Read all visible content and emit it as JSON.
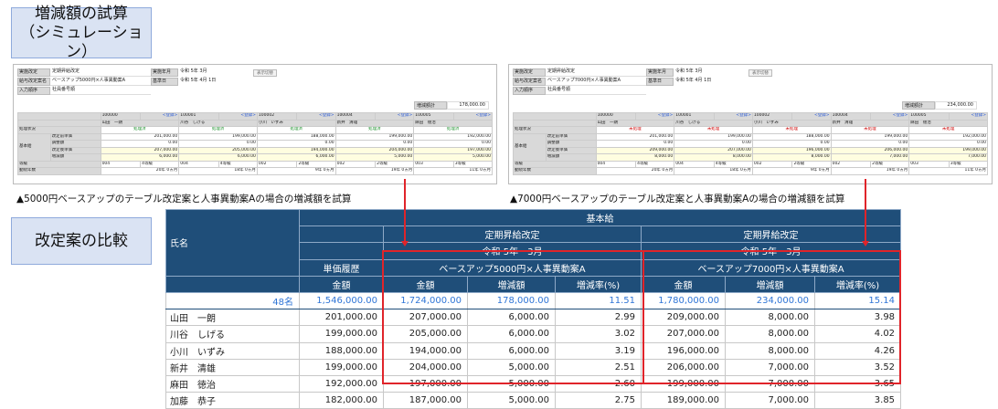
{
  "labels": {
    "trial_line1": "増減額の試算",
    "trial_line2": "（シミュレーション）",
    "compare": "改定案の比較"
  },
  "captions": {
    "left": "▲5000円ベースアップのテーブル改定案と人事異動案Aの場合の増減額を試算",
    "right": "▲7000円ベースアップのテーブル改定案と人事異動案Aの場合の増減額を試算"
  },
  "shots": [
    {
      "info": {
        "impl_k": "実施改定",
        "impl_v": "定期昇給改定",
        "plan_k": "給与改定案名",
        "plan_v": "ベースアップ5000円×人事異動案A",
        "order_k": "入力順序",
        "order_v": "社員番号順",
        "ym_k": "実施年月",
        "ym_v": "令和 5年 3月",
        "base_k": "基準日",
        "base_v": "令和 5年 4月 1日",
        "btn": "表示切替"
      },
      "total": {
        "k": "増減額計",
        "v": "178,000.00"
      },
      "grid": {
        "row_labels": {
          "status": "処理状況",
          "base": "基本給",
          "grade": "等級",
          "tenure": "勤続年数"
        },
        "sub_labels": [
          "改定前単価",
          "調整額",
          "改定後単価",
          "増減額"
        ],
        "link": "<登録>",
        "emps": [
          {
            "id": "100000",
            "name": "山田　一朗",
            "status": "処理済",
            "before": "201,000.00",
            "adj": "0.00",
            "after": "207,000.00",
            "diff": "6,000.00",
            "grade_code": "004",
            "grade_name": "4等級",
            "tenure": "20年 0ヵ月"
          },
          {
            "id": "100001",
            "name": "川谷　しげる",
            "status": "処理済",
            "before": "199,000.00",
            "adj": "0.00",
            "after": "205,000.00",
            "diff": "6,000.00",
            "grade_code": "004",
            "grade_name": "4等級",
            "tenure": "18年 0ヵ月"
          },
          {
            "id": "100002",
            "name": "小川　いずみ",
            "status": "処理済",
            "before": "188,000.00",
            "adj": "0.00",
            "after": "194,000.00",
            "diff": "6,000.00",
            "grade_code": "002",
            "grade_name": "2等級",
            "tenure": "9年 0ヵ月"
          },
          {
            "id": "100004",
            "name": "新井　清雄",
            "status": "処理済",
            "before": "199,000.00",
            "adj": "0.00",
            "after": "204,000.00",
            "diff": "5,000.00",
            "grade_code": "002",
            "grade_name": "2等級",
            "tenure": "19年 0ヵ月"
          },
          {
            "id": "100005",
            "name": "麻田　徳治",
            "status": "処理済",
            "before": "192,000.00",
            "adj": "0.00",
            "after": "197,000.00",
            "diff": "5,000.00",
            "grade_code": "003",
            "grade_name": "3等級",
            "tenure": "11年 0ヵ月"
          }
        ]
      }
    },
    {
      "info": {
        "impl_k": "実施改定",
        "impl_v": "定期昇給改定",
        "plan_k": "給与改定案名",
        "plan_v": "ベースアップ7000円×人事異動案A",
        "order_k": "入力順序",
        "order_v": "社員番号順",
        "ym_k": "実施年月",
        "ym_v": "令和 5年 3月",
        "base_k": "基準日",
        "base_v": "令和 5年 4月 1日",
        "btn": "表示切替"
      },
      "total": {
        "k": "増減額計",
        "v": "234,000.00"
      },
      "grid": {
        "row_labels": {
          "status": "処理状況",
          "base": "基本給",
          "grade": "等級",
          "tenure": "勤続年数"
        },
        "sub_labels": [
          "改定前単価",
          "調整額",
          "改定後単価",
          "増減額"
        ],
        "link": "<登録>",
        "emps": [
          {
            "id": "100000",
            "name": "山田　一朗",
            "status": "未処理",
            "before": "201,000.00",
            "adj": "0.00",
            "after": "209,000.00",
            "diff": "8,000.00",
            "grade_code": "004",
            "grade_name": "4等級",
            "tenure": "20年 0ヵ月"
          },
          {
            "id": "100001",
            "name": "川谷　しげる",
            "status": "未処理",
            "before": "199,000.00",
            "adj": "0.00",
            "after": "207,000.00",
            "diff": "8,000.00",
            "grade_code": "004",
            "grade_name": "4等級",
            "tenure": "18年 0ヵ月"
          },
          {
            "id": "100002",
            "name": "小川　いずみ",
            "status": "未処理",
            "before": "188,000.00",
            "adj": "0.00",
            "after": "196,000.00",
            "diff": "8,000.00",
            "grade_code": "002",
            "grade_name": "2等級",
            "tenure": "9年 0ヵ月"
          },
          {
            "id": "100004",
            "name": "新井　清雄",
            "status": "未処理",
            "before": "199,000.00",
            "adj": "0.00",
            "after": "206,000.00",
            "diff": "7,000.00",
            "grade_code": "002",
            "grade_name": "2等級",
            "tenure": "19年 0ヵ月"
          },
          {
            "id": "100005",
            "name": "麻田　徳治",
            "status": "未処理",
            "before": "192,000.00",
            "adj": "0.00",
            "after": "199,000.00",
            "diff": "7,000.00",
            "grade_code": "003",
            "grade_name": "3等級",
            "tenure": "11年 0ヵ月"
          }
        ]
      }
    }
  ],
  "compare": {
    "h_base": "基本給",
    "h_name": "氏名",
    "h_cat1": "定期昇給改定",
    "h_cat2": "定期昇給改定",
    "h_ym1": "令和 5年　3月",
    "h_ym2": "令和 5年　3月",
    "h_hist": "単価履歴",
    "h_plan1": "ベースアップ5000円×人事異動案A",
    "h_plan2": "ベースアップ7000円×人事異動案A",
    "h_amt0": "金額",
    "h_amt1": "金額",
    "h_diff1": "増減額",
    "h_rate1": "増減率(%)",
    "h_amt2": "金額",
    "h_diff2": "増減額",
    "h_rate2": "増減率(%)",
    "count": "48名",
    "totals": [
      "1,546,000.00",
      "1,724,000.00",
      "178,000.00",
      "11.51",
      "1,780,000.00",
      "234,000.00",
      "15.14"
    ],
    "rows": [
      {
        "name": "山田　一朗",
        "base": "201,000.00",
        "a1": "207,000.00",
        "d1": "6,000.00",
        "r1": "2.99",
        "a2": "209,000.00",
        "d2": "8,000.00",
        "r2": "3.98"
      },
      {
        "name": "川谷　しげる",
        "base": "199,000.00",
        "a1": "205,000.00",
        "d1": "6,000.00",
        "r1": "3.02",
        "a2": "207,000.00",
        "d2": "8,000.00",
        "r2": "4.02"
      },
      {
        "name": "小川　いずみ",
        "base": "188,000.00",
        "a1": "194,000.00",
        "d1": "6,000.00",
        "r1": "3.19",
        "a2": "196,000.00",
        "d2": "8,000.00",
        "r2": "4.26"
      },
      {
        "name": "新井　清雄",
        "base": "199,000.00",
        "a1": "204,000.00",
        "d1": "5,000.00",
        "r1": "2.51",
        "a2": "206,000.00",
        "d2": "7,000.00",
        "r2": "3.52"
      },
      {
        "name": "麻田　徳治",
        "base": "192,000.00",
        "a1": "197,000.00",
        "d1": "5,000.00",
        "r1": "2.60",
        "a2": "199,000.00",
        "d2": "7,000.00",
        "r2": "3.65"
      },
      {
        "name": "加藤　恭子",
        "base": "182,000.00",
        "a1": "187,000.00",
        "d1": "5,000.00",
        "r1": "2.75",
        "a2": "189,000.00",
        "d2": "7,000.00",
        "r2": "3.85"
      }
    ]
  }
}
